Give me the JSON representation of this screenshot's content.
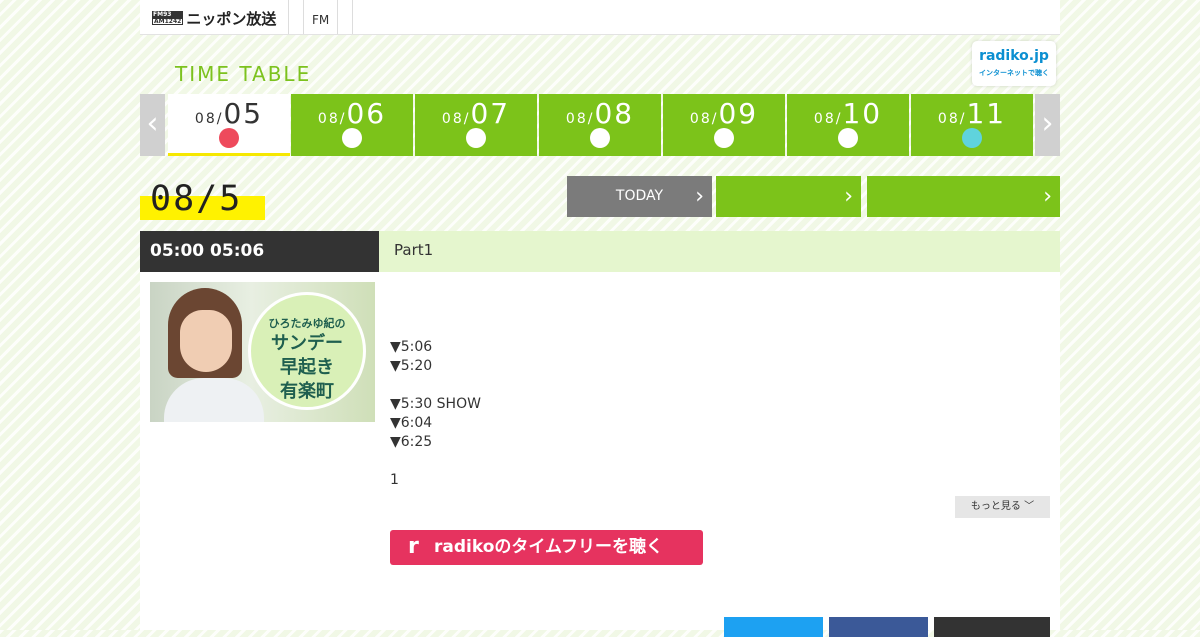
{
  "header": {
    "logo_mark_top": "FM93",
    "logo_mark_bottom": "AM1242",
    "logo_text": "ニッポン放送",
    "nav": [
      "FM"
    ]
  },
  "timetable": {
    "title": "TIME TABLE",
    "radiko_logo": "radiko.jp",
    "radiko_logo_sub": "インターネットで聴く"
  },
  "days": [
    {
      "month": "08/",
      "day": "05",
      "active": true
    },
    {
      "month": "08/",
      "day": "06"
    },
    {
      "month": "08/",
      "day": "07"
    },
    {
      "month": "08/",
      "day": "08"
    },
    {
      "month": "08/",
      "day": "09"
    },
    {
      "month": "08/",
      "day": "10"
    },
    {
      "month": "08/",
      "day": "11"
    }
  ],
  "date_heading": "08/5",
  "buttons": {
    "today": "TODAY"
  },
  "program": {
    "time": "05:00  05:06",
    "title": "Part1",
    "thumb_text_1": "ひろたみゆ紀の",
    "thumb_text_2": "サンデー",
    "thumb_text_3": "早起き",
    "thumb_text_4": "有楽町",
    "description": "▼5:06\n▼5:20\n\n▼5:30 SHOW\n▼6:04\n▼6:25\n\n1",
    "more_label": "もっと見る ﹀",
    "radiko_button": "radikoのタイムフリーを聴く"
  },
  "colors": {
    "accent": "#7cc31a",
    "today_dot": "#ee4a5c",
    "radiko": "#e6335f"
  }
}
